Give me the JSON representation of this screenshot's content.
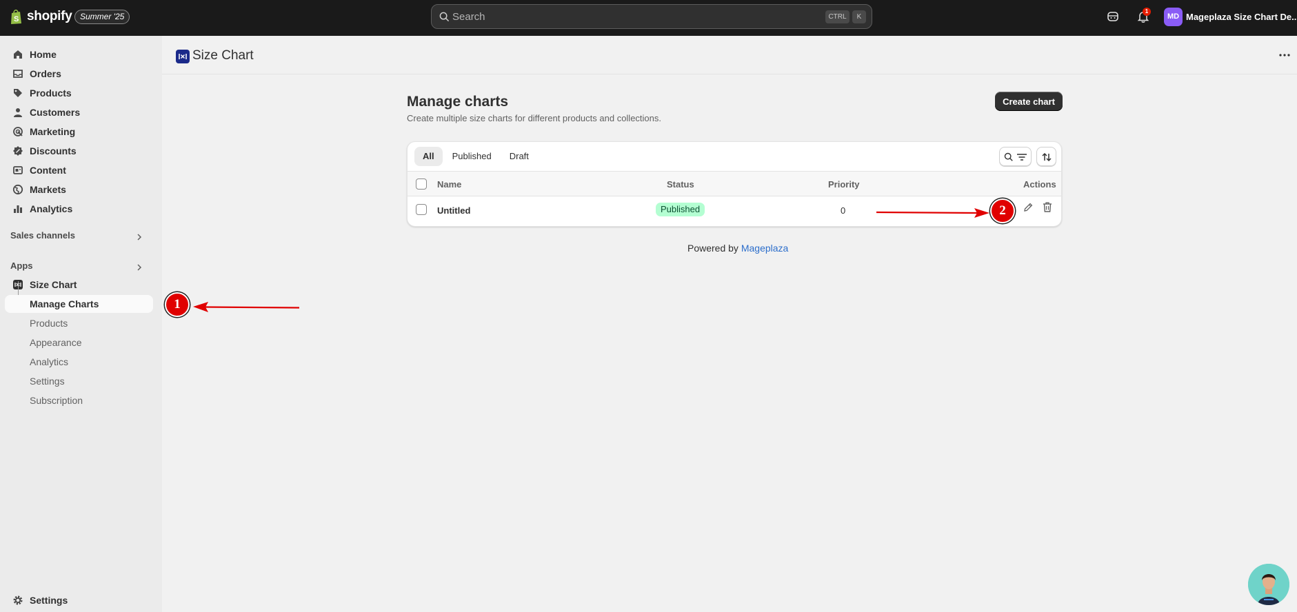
{
  "topbar": {
    "brand": "shopify",
    "edition_badge": "Summer '25",
    "search_placeholder": "Search",
    "shortcut_ctrl": "CTRL",
    "shortcut_key": "K",
    "notification_count": "1",
    "avatar_initials": "MD",
    "store_name": "Mageplaza Size Chart De..."
  },
  "sidebar": {
    "items": [
      {
        "label": "Home",
        "icon": "home-icon"
      },
      {
        "label": "Orders",
        "icon": "inbox-icon"
      },
      {
        "label": "Products",
        "icon": "tag-icon"
      },
      {
        "label": "Customers",
        "icon": "person-icon"
      },
      {
        "label": "Marketing",
        "icon": "target-icon"
      },
      {
        "label": "Discounts",
        "icon": "discount-icon"
      },
      {
        "label": "Content",
        "icon": "content-icon"
      },
      {
        "label": "Markets",
        "icon": "globe-icon"
      },
      {
        "label": "Analytics",
        "icon": "bar-chart-icon"
      }
    ],
    "sales_channels_label": "Sales channels",
    "apps_label": "Apps",
    "app_name": "Size Chart",
    "app_sub_items": [
      "Manage Charts",
      "Products",
      "Appearance",
      "Analytics",
      "Settings",
      "Subscription"
    ],
    "settings_label": "Settings"
  },
  "page": {
    "app_title": "Size Chart",
    "title": "Manage charts",
    "subtitle": "Create multiple size charts for different products and collections.",
    "create_button": "Create chart",
    "tabs": [
      "All",
      "Published",
      "Draft"
    ],
    "columns": {
      "name": "Name",
      "status": "Status",
      "priority": "Priority",
      "actions": "Actions"
    },
    "rows": [
      {
        "name": "Untitled",
        "status": "Published",
        "priority": "0"
      }
    ],
    "powered_by_prefix": "Powered by",
    "powered_by_link": "Mageplaza"
  },
  "annotations": {
    "callout_1": "1",
    "callout_2": "2"
  },
  "colors": {
    "topbar": "#1a1a1a",
    "accent_red": "#e00000",
    "published_badge": "#b4fed2",
    "link": "#2c6ecb"
  }
}
